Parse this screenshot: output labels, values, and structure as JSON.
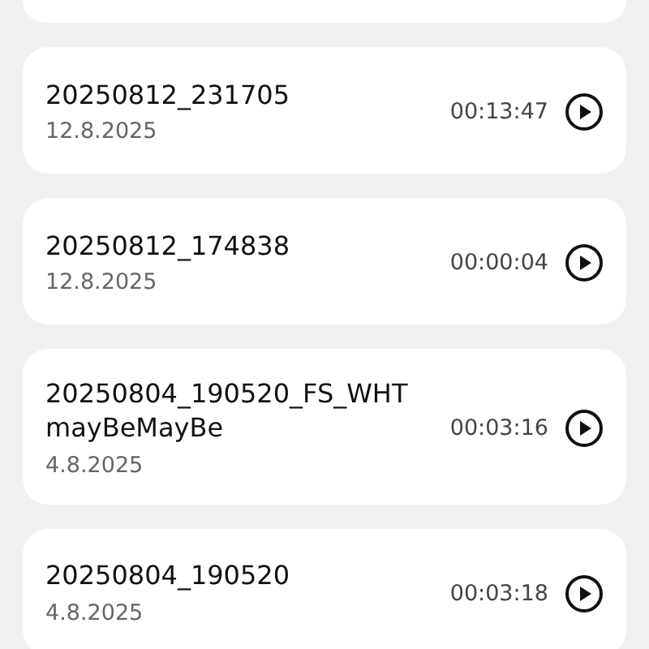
{
  "recordings": [
    {
      "name": "20250812_231705",
      "date": "12.8.2025",
      "duration": "00:13:47"
    },
    {
      "name": "20250812_174838",
      "date": "12.8.2025",
      "duration": "00:00:04"
    },
    {
      "name": "20250804_190520_FS_WHT mayBeMayBe",
      "date": "4.8.2025",
      "duration": "00:03:16"
    },
    {
      "name": "20250804_190520",
      "date": "4.8.2025",
      "duration": "00:03:18"
    }
  ]
}
